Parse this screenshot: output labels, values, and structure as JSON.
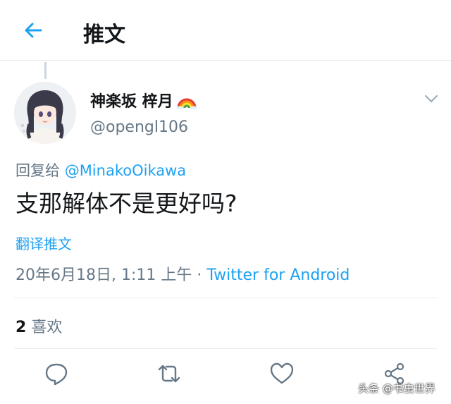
{
  "header": {
    "back_icon": "arrow-left-icon",
    "title": "推文"
  },
  "author": {
    "name": "神楽坂 梓月",
    "emoji": "rainbow-icon",
    "handle": "@opengl106"
  },
  "reply": {
    "prefix": "回复给",
    "mention": "@MinakoOikawa"
  },
  "tweet": {
    "text": "支那解体不是更好吗?"
  },
  "translate_label": "翻译推文",
  "meta": {
    "timestamp": "20年6月18日, 1:11 上午",
    "separator": " · ",
    "source": "Twitter for Android"
  },
  "likes": {
    "count": "2",
    "label": "喜欢"
  },
  "actions": [
    "reply-icon",
    "retweet-icon",
    "like-icon",
    "share-icon"
  ],
  "watermark": "头条 @书虫世界",
  "colors": {
    "accent": "#1da1f2",
    "muted": "#657786",
    "text": "#14171a",
    "border": "#e6ecf0"
  }
}
